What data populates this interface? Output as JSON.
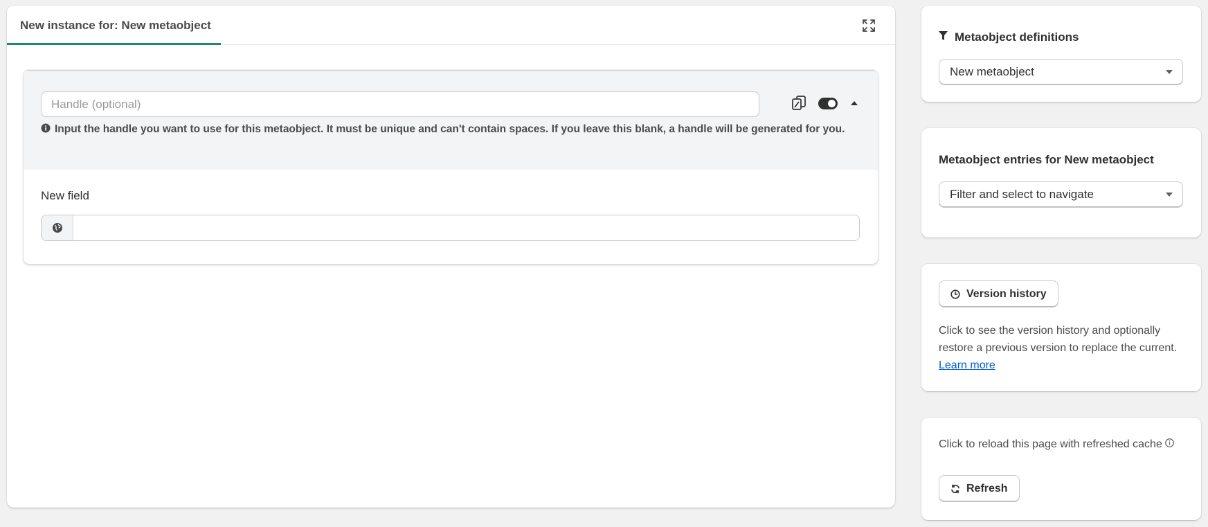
{
  "main": {
    "tab_label": "New instance for: New metaobject",
    "entry": {
      "handle_placeholder": "Handle (optional)",
      "handle_value": "",
      "help_text": "Input the handle you want to use for this metaobject. It must be unique and can't contain spaces. If you leave this blank, a handle will be generated for you.",
      "field_label": "New field",
      "field_value": ""
    }
  },
  "sidebar": {
    "definitions": {
      "heading": "Metaobject definitions",
      "selected": "New metaobject"
    },
    "entries": {
      "heading": "Metaobject entries for New metaobject",
      "selected": "Filter and select to navigate"
    },
    "history": {
      "button_label": "Version history",
      "description": "Click to see the version history and optionally restore a previous version to replace the current.",
      "link_label": "Learn more"
    },
    "refresh": {
      "description": "Click to reload this page with refreshed cache",
      "button_label": "Refresh"
    }
  },
  "colors": {
    "accent": "#1d8a6a",
    "link": "#005bd3",
    "text": "#303030",
    "background": "#f1f1f1"
  },
  "icons": {
    "expand": "expand-icon",
    "copy": "copy-icon",
    "toggle": "toggle-icon",
    "collapse": "chevron-up-icon",
    "info": "info-icon",
    "globe": "globe-icon",
    "filter": "filter-icon",
    "clock": "clock-icon",
    "refresh": "refresh-icon"
  }
}
